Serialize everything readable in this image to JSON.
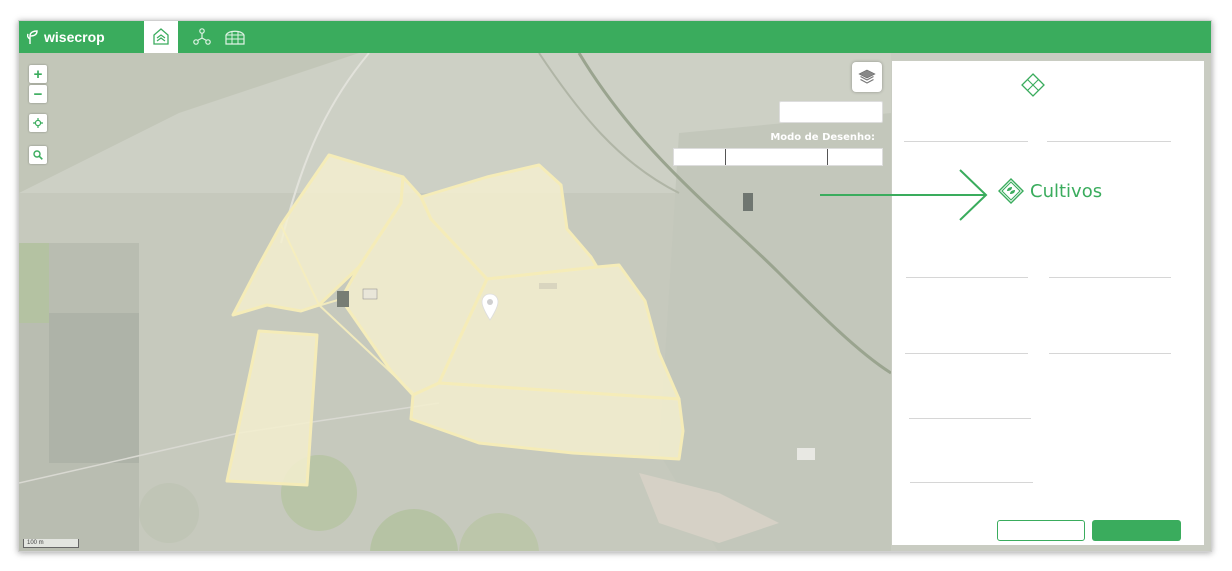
{
  "brand": {
    "name": "wisecrop",
    "color": "#3aac5d"
  },
  "nav": {
    "tabs": [
      {
        "icon": "farm-field-icon",
        "active": true
      },
      {
        "icon": "sensor-network-icon",
        "active": false
      },
      {
        "icon": "greenhouse-icon",
        "active": false
      }
    ]
  },
  "map": {
    "zoom_in_label": "+",
    "zoom_out_label": "−",
    "locate_icon": "crosshair-icon",
    "search_icon": "search-icon",
    "layers_icon": "layers-icon",
    "draw_mode_label": "Modo de Desenho:",
    "scale_label": "100 m",
    "marker_icon": "map-marker-icon"
  },
  "annotation": {
    "label": "Cultivos",
    "icon": "crops-icon"
  },
  "panel": {
    "header_icon": "field-diamond-icon"
  }
}
